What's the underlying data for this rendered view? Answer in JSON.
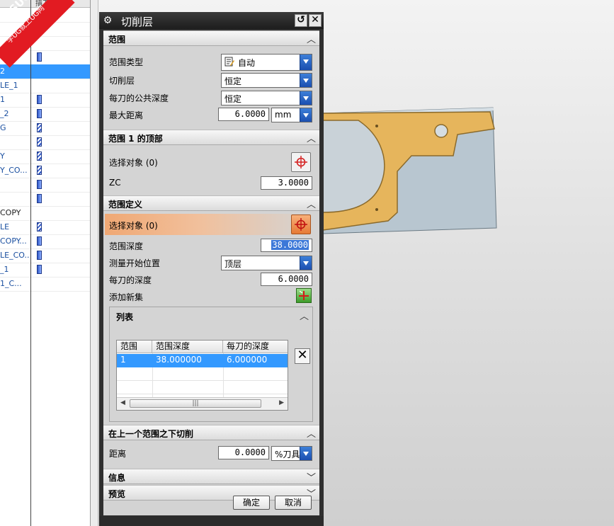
{
  "navigator": {
    "header_label": "描刀",
    "logo_text": "9SUG",
    "logo_subtext": "学UG就上UG网",
    "rows": [
      {
        "name": "",
        "icon": ""
      },
      {
        "name": "",
        "icon": ""
      },
      {
        "name": "",
        "icon": ""
      },
      {
        "name": "",
        "icon": "solid"
      },
      {
        "name": "2",
        "icon": ""
      },
      {
        "name": "LE_1",
        "icon": ""
      },
      {
        "name": "1",
        "icon": "solid"
      },
      {
        "name": "_2",
        "icon": "solid"
      },
      {
        "name": "G",
        "icon": "pen"
      },
      {
        "name": "",
        "icon": "pen"
      },
      {
        "name": "Y",
        "icon": "pen"
      },
      {
        "name": "Y_CO...",
        "icon": "pen"
      },
      {
        "name": "",
        "icon": "solid"
      },
      {
        "name": "",
        "icon": "solid"
      },
      {
        "name": "COPY",
        "icon": ""
      },
      {
        "name": "LE",
        "icon": "pen"
      },
      {
        "name": "COPY...",
        "icon": "solid"
      },
      {
        "name": "LE_CO...",
        "icon": "solid"
      },
      {
        "name": "_1",
        "icon": "solid"
      },
      {
        "name": "1_C...",
        "icon": ""
      }
    ],
    "selected_index": 4
  },
  "dialog": {
    "title": "切削层",
    "reset_icon": "reset-icon",
    "close_icon": "close-icon",
    "sections": {
      "range": {
        "title": "范围",
        "range_type_label": "范围类型",
        "range_type_value": "自动",
        "cut_levels_label": "切削层",
        "cut_levels_value": "恒定",
        "common_depth_label": "每刀的公共深度",
        "common_depth_value": "恒定",
        "max_distance_label": "最大距离",
        "max_distance_value": "6.0000",
        "max_distance_unit": "mm"
      },
      "range_top": {
        "title": "范围 1 的顶部",
        "select_object_label": "选择对象 (0)",
        "zc_label": "ZC",
        "zc_value": "3.0000"
      },
      "range_def": {
        "title": "范围定义",
        "select_object_label": "选择对象 (0)",
        "range_depth_label": "范围深度",
        "range_depth_value": "38.0000",
        "measure_from_label": "测量开始位置",
        "measure_from_value": "顶层",
        "depth_per_cut_label": "每刀的深度",
        "depth_per_cut_value": "6.0000",
        "add_new_set_label": "添加新集"
      },
      "list": {
        "title": "列表",
        "columns": [
          "范围",
          "范围深度",
          "每刀的深度"
        ],
        "rows": [
          [
            "1",
            "38.000000",
            "6.000000"
          ]
        ]
      },
      "below_last": {
        "title": "在上一个范围之下切削",
        "distance_label": "距离",
        "distance_value": "0.0000",
        "distance_unit": "%刀具"
      },
      "info": {
        "title": "信息"
      },
      "preview": {
        "title": "预览"
      }
    },
    "ok_label": "确定",
    "cancel_label": "取消"
  },
  "colors": {
    "selection_blue": "#3399ff",
    "dropdown_blue": "#2a63c4",
    "active_select_orange": "#e67a35",
    "part_face": "#e8b85a",
    "part_stock": "#b9c6cf"
  }
}
